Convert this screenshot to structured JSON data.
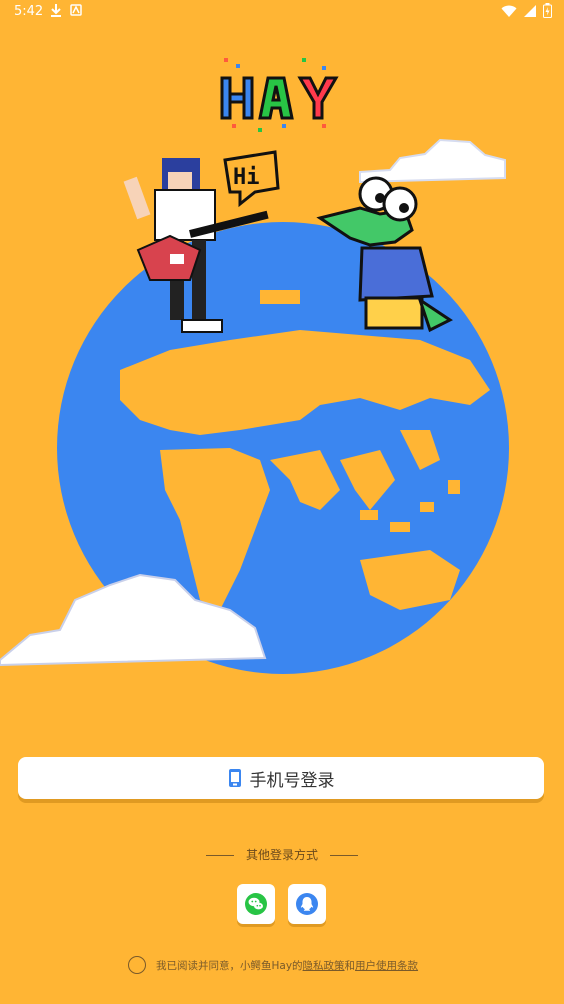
{
  "status_bar": {
    "time": "5:42"
  },
  "brand": {
    "logo_text": "HAY",
    "speech_bubble": "Hi"
  },
  "login": {
    "phone_button_label": "手机号登录"
  },
  "other_login": {
    "title": "其他登录方式",
    "options": [
      "wechat-icon",
      "qq-icon"
    ]
  },
  "agreement": {
    "prefix": "我已阅读并同意，小鳄鱼Hay的",
    "privacy_label": "隐私政策",
    "and": "和",
    "terms_label": "用户使用条款"
  },
  "colors": {
    "background": "#FFB534",
    "ocean": "#3B86F0",
    "land": "#FFB534",
    "wechat": "#28C445",
    "qq": "#3B86F0",
    "croc": "#43C868"
  }
}
